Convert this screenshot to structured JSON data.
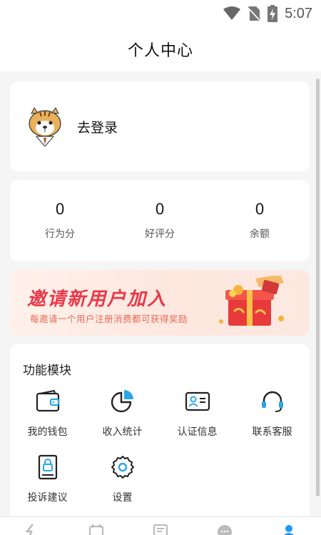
{
  "status_bar": {
    "time": "5:07"
  },
  "header": {
    "title": "个人中心"
  },
  "login": {
    "text": "去登录"
  },
  "stats": [
    {
      "value": "0",
      "label": "行为分"
    },
    {
      "value": "0",
      "label": "好评分"
    },
    {
      "value": "0",
      "label": "余额"
    }
  ],
  "banner": {
    "title": "邀请新用户加入",
    "subtitle": "每邀请一个用户注册消费都可获得奖励"
  },
  "functions": {
    "title": "功能模块",
    "items": [
      {
        "label": "我的钱包",
        "icon": "wallet-icon"
      },
      {
        "label": "收入统计",
        "icon": "pie-chart-icon"
      },
      {
        "label": "认证信息",
        "icon": "id-card-icon"
      },
      {
        "label": "联系客服",
        "icon": "headset-icon"
      },
      {
        "label": "投诉建议",
        "icon": "complaint-icon"
      },
      {
        "label": "设置",
        "icon": "gear-icon"
      }
    ]
  },
  "colors": {
    "accent": "#2196f3",
    "banner_red": "#e8394a",
    "icon_blue": "#2aa6e6"
  }
}
